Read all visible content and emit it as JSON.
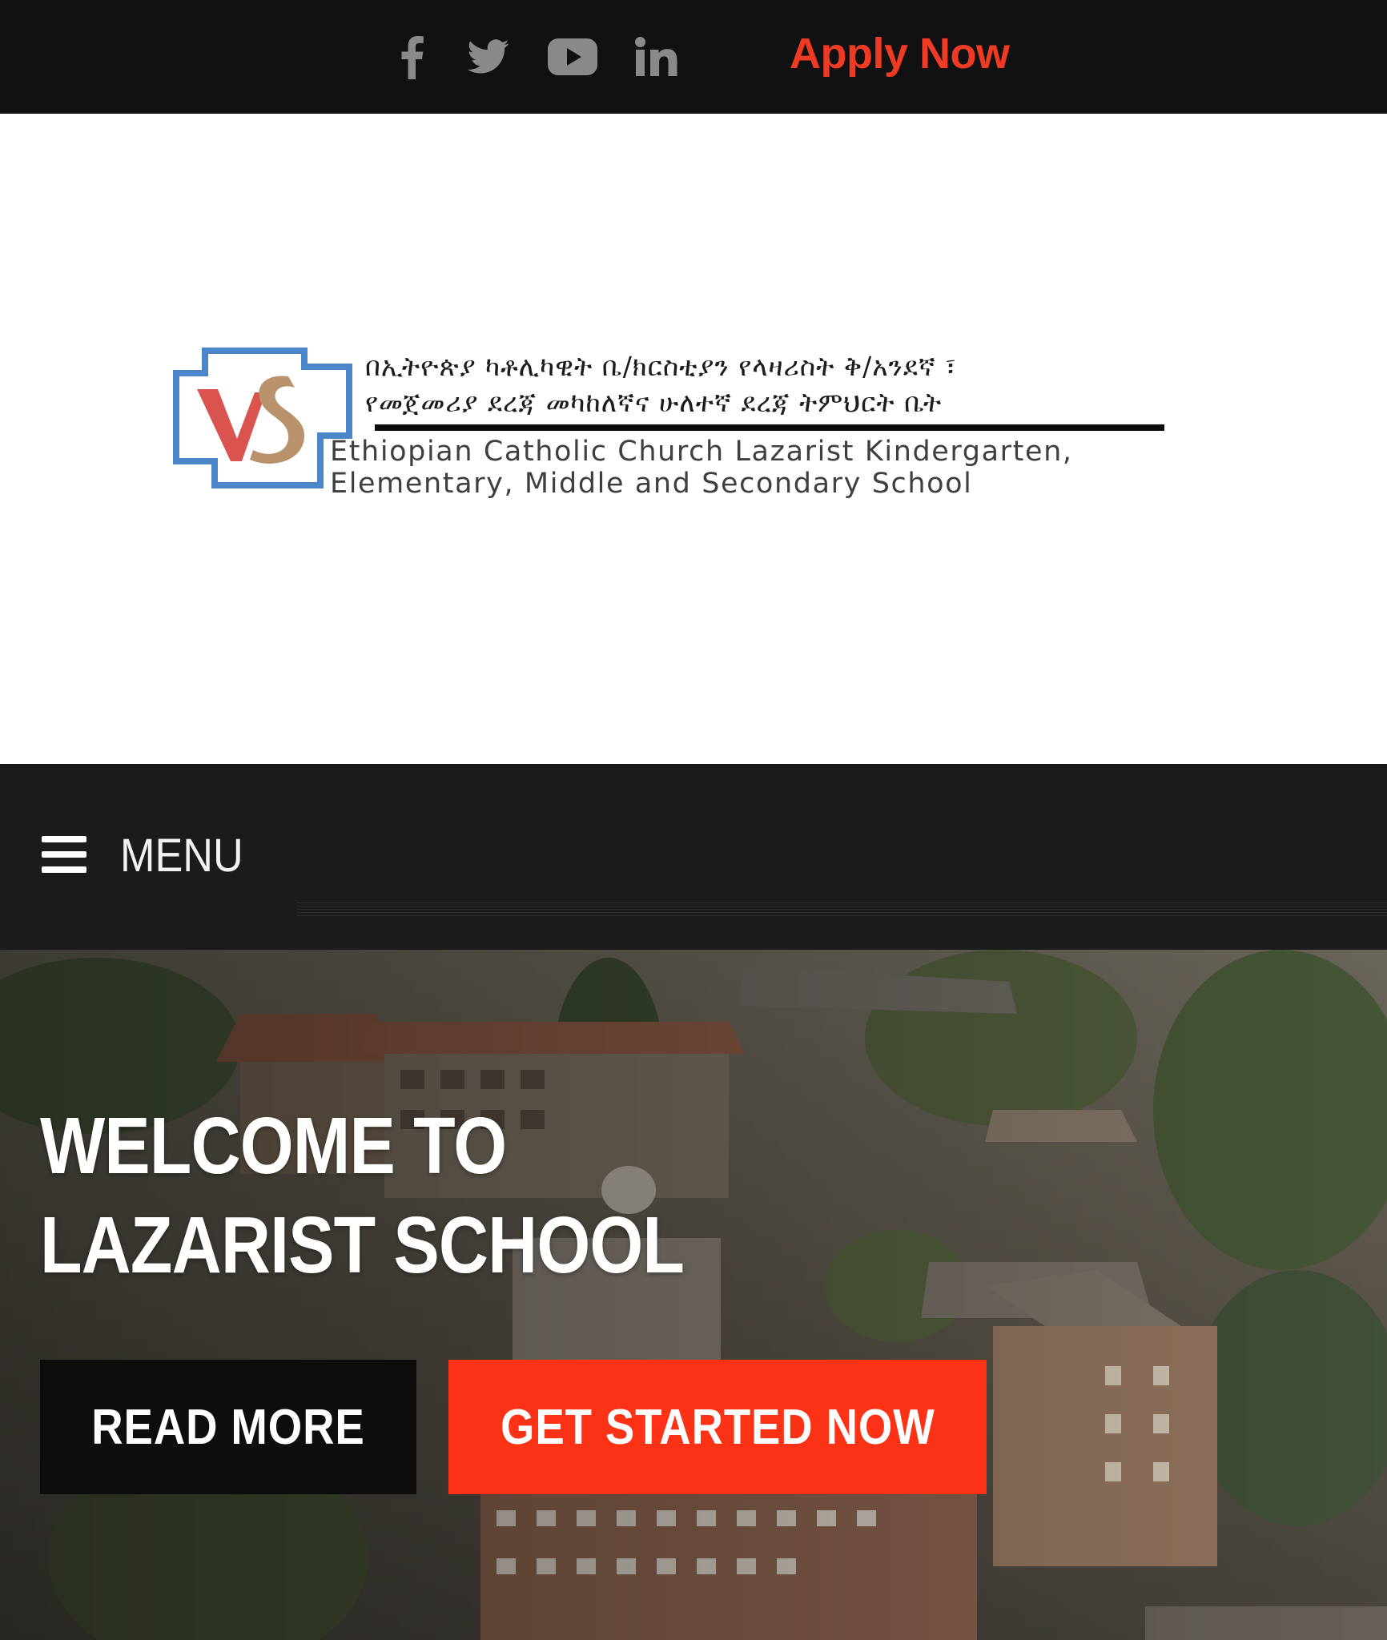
{
  "topbar": {
    "social_icons": [
      "facebook-icon",
      "twitter-icon",
      "youtube-icon",
      "linkedin-icon"
    ],
    "apply_label": "Apply Now",
    "accent_color": "#ef3b23"
  },
  "logo": {
    "amharic_line1": "በኢትዮጵያ ካቶሊካዊት ቤ/ክርስቲያን የላዛሪስት ቅ/አንደኛ ፣",
    "amharic_line2": "የመጀመሪያ ደረጃ መካከለኛና ሁለተኛ ደረጃ ትምህርት ቤት",
    "english_line1": "Ethiopian Catholic Church Lazarist Kindergarten,",
    "english_line2": "Elementary, Middle and Secondary School"
  },
  "menu": {
    "icon": "hamburger-icon",
    "label": "MENU"
  },
  "hero": {
    "title_line1": "WELCOME TO",
    "title_line2": "LAZARIST SCHOOL",
    "read_more_label": "READ MORE",
    "get_started_label": "GET STARTED NOW",
    "get_started_color": "#fb3216"
  }
}
